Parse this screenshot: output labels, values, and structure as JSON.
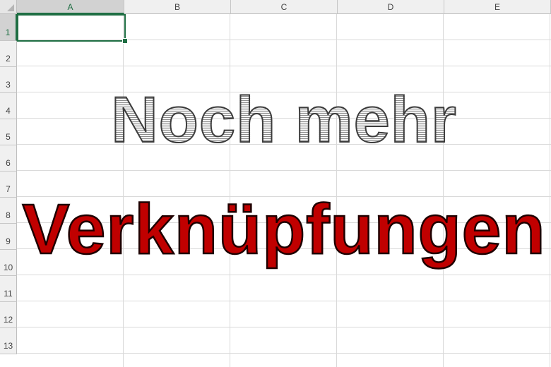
{
  "columns": [
    {
      "label": "A"
    },
    {
      "label": "B"
    },
    {
      "label": "C"
    },
    {
      "label": "D"
    },
    {
      "label": "E"
    }
  ],
  "rows": [
    "1",
    "2",
    "3",
    "4",
    "5",
    "6",
    "7",
    "8",
    "9",
    "10",
    "11",
    "12",
    "13"
  ],
  "selection": {
    "column": "A",
    "row": "1"
  },
  "wordart": {
    "line1": "Noch mehr",
    "line2": "Verknüpfungen",
    "line1_color": "#9a9a9a",
    "line2_color": "#c00000"
  },
  "colors": {
    "accent": "#1f6e43",
    "header_bg": "#f0f0f0",
    "gridline": "#d9d9d9"
  }
}
